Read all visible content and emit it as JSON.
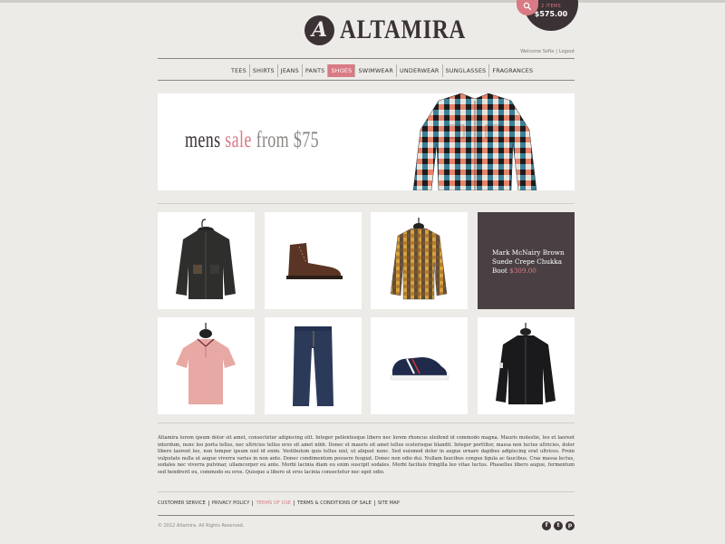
{
  "brand": {
    "logo_letter": "A",
    "name": "ALTAMIRA"
  },
  "cart": {
    "items": "2 ITEMS",
    "total": "$575.00",
    "search_icon": "search-icon"
  },
  "account": {
    "welcome": "Welcome Sofia",
    "separator": "|",
    "logout": "Logout"
  },
  "nav": {
    "items": [
      {
        "label": "TEES"
      },
      {
        "label": "SHIRTS"
      },
      {
        "label": "JEANS"
      },
      {
        "label": "PANTS"
      },
      {
        "label": "SHOES",
        "active": true
      },
      {
        "label": "SWIMWEAR"
      },
      {
        "label": "UNDERWEAR"
      },
      {
        "label": "SUNGLASSES"
      },
      {
        "label": "FRAGRANCES"
      }
    ]
  },
  "banner": {
    "part1": "mens ",
    "part2": "sale",
    "part3": " from $75"
  },
  "featured": {
    "name": "Mark McNairy Brown Suede Crepe Chukka Boot",
    "price": "$309.00"
  },
  "products": [
    {
      "name": "jacket",
      "icon": "jacket-image"
    },
    {
      "name": "boot",
      "icon": "boot-image"
    },
    {
      "name": "plaid shirt",
      "icon": "shirt-image"
    },
    {
      "name": "polo",
      "icon": "polo-image"
    },
    {
      "name": "jeans",
      "icon": "jeans-image"
    },
    {
      "name": "sneaker",
      "icon": "sneaker-image"
    },
    {
      "name": "track jacket",
      "icon": "track-jacket-image"
    }
  ],
  "body_text": "Altamira lorem ipsum dolor sit amet, consectetur adipiscing elit. Integer pellentesque libero nec lorem rhoncus eleifend id commodo magna. Mauris molestie, leo et laoreet interdum, nunc leo porta tellus, nec ultricies tellus eros sit amet nibh. Donec et mauris sit amet tellus scelerisque blandit. Integer porttitor, massa non luctus ultricies, dolor libero laoreet leo, non tempor ipsum nisl id enim. Vestibulum quis tellus nisl, ut aliquet nunc. Sed euismod dolor in augue ornare dapibus adipiscing erat ultrices. Proin vulputate nulla ut augue viverra varius in non ante. Donec condimentum posuere feugiat. Donec non odio dui. Nullam faucibus congue ligula ac faucibus. Cras massa lectus, sodales nec viverra pulvinar, ullamcorper eu ante. Morbi lacinia diam eu enim suscipit sodales. Morbi facilisis fringilla leo vitae luctus. Phasellus libero augue, fermentum sed hendrerit eu, commodo eu eros. Quisque a libero ut eros lacinia consectetur nec eget odio.",
  "footer": {
    "links": [
      {
        "label": "CUSTOMER SERVICE"
      },
      {
        "label": "PRIVACY POLICY"
      },
      {
        "label": "TERMS OF USE",
        "active": true
      },
      {
        "label": "TERMS & CONDITIONS OF SALE"
      },
      {
        "label": "SITE MAP"
      }
    ],
    "copyright": "© 2012 Altamira. All Rights Reserved.",
    "social": [
      {
        "label": "f",
        "icon": "facebook-icon"
      },
      {
        "label": "t",
        "icon": "twitter-icon"
      },
      {
        "label": "p",
        "icon": "pinterest-icon"
      }
    ]
  },
  "colors": {
    "accent": "#d97a84",
    "dark": "#3a3234",
    "background": "#ecebe7"
  }
}
